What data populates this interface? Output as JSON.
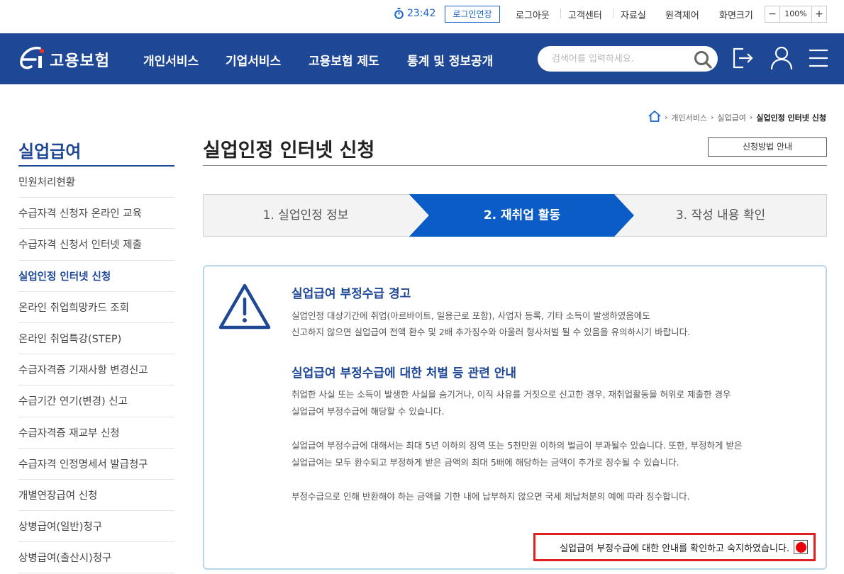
{
  "util": {
    "timer": "23:42",
    "extend_button": "로그인연장",
    "links": [
      "로그아웃",
      "고객센터",
      "자료실",
      "원격제어"
    ],
    "zoom_label": "화면크기",
    "zoom_minus": "−",
    "zoom_value": "100%",
    "zoom_plus": "+"
  },
  "header": {
    "logo_text": "고용보험",
    "nav": [
      "개인서비스",
      "기업서비스",
      "고용보험 제도",
      "통계 및 정보공개"
    ],
    "search_placeholder": "검색어를 입력하세요.",
    "brand_color": "#1e4796"
  },
  "breadcrumb": {
    "items": [
      "개인서비스",
      "실업급여"
    ],
    "current": "실업인정 인터넷 신청"
  },
  "sidebar": {
    "title": "실업급여",
    "items": [
      "민원처리현황",
      "수급자격 신청자 온라인 교육",
      "수급자격 신청서 인터넷 제출",
      "실업인정 인터넷 신청",
      "온라인 취업희망카드 조회",
      "온라인 취업특강(STEP)",
      "수급자격증 기재사항 변경신고",
      "수급기간 연기(변경) 신고",
      "수급자격증 재교부 신청",
      "수급자격 인정명세서 발급청구",
      "개별연장급여 신청",
      "상병급여(일반)청구",
      "상병급여(출산시)청구"
    ],
    "active_index": 3
  },
  "main": {
    "title": "실업인정 인터넷 신청",
    "guide_button": "신청방법 안내",
    "steps": [
      "1. 실업인정 정보",
      "2. 재취업 활동",
      "3. 작성 내용 확인"
    ],
    "active_step": 1,
    "notice": {
      "title1": "실업급여 부정수급 경고",
      "text1a": "실업인정 대상기간에 취업(아르바이트, 일용근로 포함), 사업자 등록, 기타 소득이 발생하였음에도",
      "text1b": "신고하지 않으면 실업급여 전액 환수 및 2배 추가징수와 아울러 형사처벌 될 수 있음을 유의하시기 바랍니다.",
      "title2": "실업급여 부정수급에 대한 처벌 등 관련 안내",
      "text2a": "취업한 사실 또는 소득이 발생한 사실을 숨기거나, 이직 사유를 거짓으로 신고한 경우, 재취업활동을 허위로 제출한 경우",
      "text2b": "실업급여 부정수급에 해당할 수 있습니다.",
      "text3a": "실업급여 부정수급에 대해서는 최대 5년 이하의 징역 또는 5천만원 이하의 벌금이 부과될수 있습니다. 또한, 부정하게 받은",
      "text3b": "실업급여는 모두 환수되고 부정하게 받은 금액의 최대 5배에 해당하는 금액이 추가로 징수될 수 있습니다.",
      "text4": "부정수급으로 인해 반환해야 하는 금액을 기한 내에 납부하지 않으면 국세 체납처분의 예에 따라 징수합니다.",
      "confirm_label": "실업급여 부정수급에 대한 안내를 확인하고 숙지하였습니다.",
      "confirm_checked": true
    }
  }
}
